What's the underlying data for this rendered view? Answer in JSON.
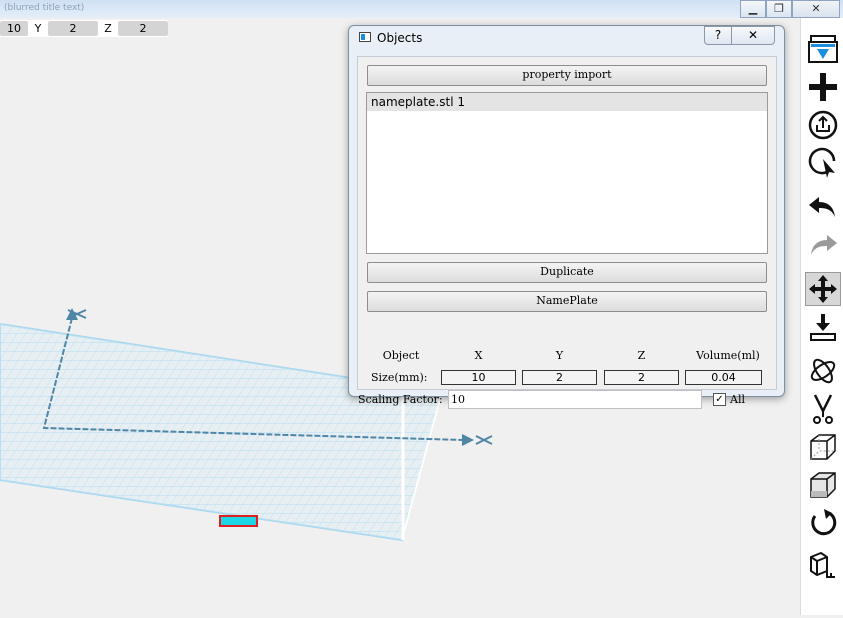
{
  "window": {
    "title_text": "(blurred title text)",
    "controls": {
      "minimize": "▁",
      "restore": "❐",
      "close": "✕"
    }
  },
  "coords": {
    "x_value": "10",
    "y_label": "Y",
    "y_value": "2",
    "z_label": "Z",
    "z_value": "2"
  },
  "dialog": {
    "title": "Objects",
    "help_label": "?",
    "close_label": "✕",
    "property_import_label": "property import",
    "objects": [
      {
        "label": "nameplate.stl 1"
      }
    ],
    "duplicate_label": "Duplicate",
    "nameplate_label": "NamePlate",
    "headers": {
      "object": "Object",
      "x": "X",
      "y": "Y",
      "z": "Z",
      "volume": "Volume(ml)"
    },
    "size_label": "Size(mm):",
    "size": {
      "x": "10",
      "y": "2",
      "z": "2",
      "volume": "0.04"
    },
    "scaling_label": "Scaling Factor:",
    "scaling_value": "10",
    "all_label": "All",
    "all_checked": true
  },
  "toolbar": {
    "tools": [
      {
        "name": "print-icon"
      },
      {
        "name": "add-icon"
      },
      {
        "name": "export-icon"
      },
      {
        "name": "select-icon"
      },
      {
        "name": "undo-icon"
      },
      {
        "name": "redo-icon"
      },
      {
        "name": "move-icon"
      },
      {
        "name": "drop-to-bed-icon"
      },
      {
        "name": "rotate-axes-icon"
      },
      {
        "name": "cut-icon"
      },
      {
        "name": "wireframe-cube-icon"
      },
      {
        "name": "solid-cube-icon"
      },
      {
        "name": "reset-view-icon"
      },
      {
        "name": "settings-icon"
      }
    ],
    "active_tool": "move-icon"
  },
  "colors": {
    "grid_line": "#a8d7ee",
    "axis": "#4f86a6",
    "object_fill": "#1ed7e6",
    "object_outline": "#e02020",
    "toolbar_blue": "#1a8fe0"
  }
}
